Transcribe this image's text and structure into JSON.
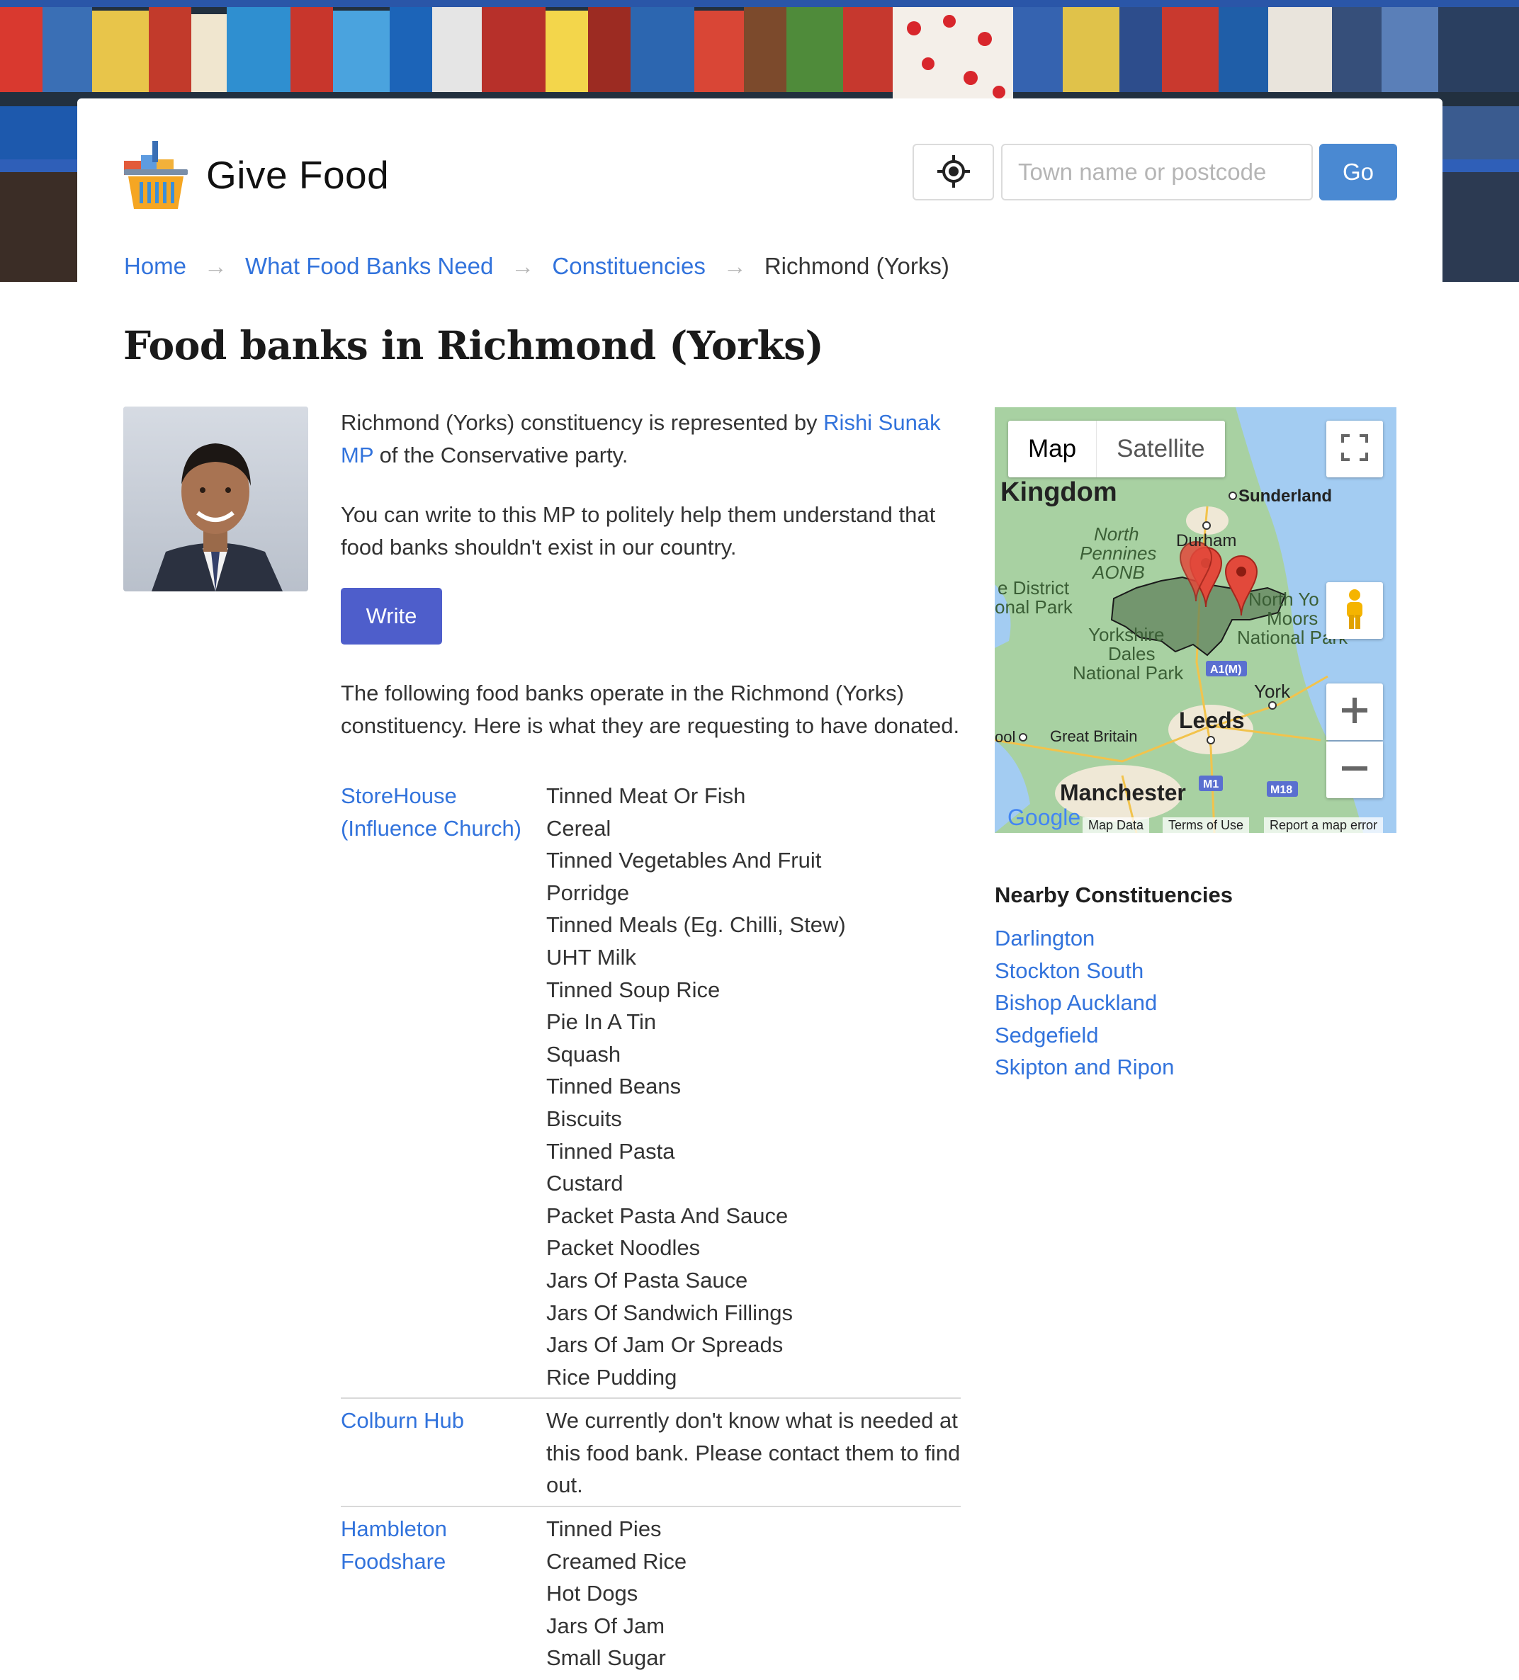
{
  "site": {
    "name": "Give Food"
  },
  "search": {
    "placeholder": "Town name or postcode",
    "go_label": "Go"
  },
  "breadcrumb": {
    "items": [
      "Home",
      "What Food Banks Need",
      "Constituencies"
    ],
    "current": "Richmond (Yorks)",
    "separator": "→"
  },
  "page": {
    "title": "Food banks in Richmond (Yorks)"
  },
  "mp": {
    "intro_before": "Richmond (Yorks) constituency is represented by ",
    "name_link": "Rishi Sunak MP",
    "intro_after": " of the Conservative party.",
    "write_text": "You can write to this MP to politely help them understand that food banks shouldn't exist in our country.",
    "write_button": "Write"
  },
  "foodbanks_intro": "The following food banks operate in the Richmond (Yorks) constituency. Here is what they are requesting to have donated.",
  "foodbanks": [
    {
      "name": "StoreHouse (Influence Church)",
      "needs": [
        "Tinned Meat Or Fish",
        "Cereal",
        "Tinned Vegetables And Fruit",
        "Porridge",
        "Tinned Meals (Eg. Chilli, Stew)",
        "UHT Milk",
        "Tinned Soup Rice",
        "Pie In A Tin",
        "Squash",
        "Tinned Beans",
        "Biscuits",
        "Tinned Pasta",
        "Custard",
        "Packet Pasta And Sauce",
        "Packet Noodles",
        "Jars Of Pasta Sauce",
        "Jars Of Sandwich Fillings",
        "Jars Of Jam Or Spreads",
        "Rice Pudding"
      ]
    },
    {
      "name": "Colburn Hub",
      "unknown": "We currently don't know what is needed at this food bank. Please contact them to find out."
    },
    {
      "name": "Hambleton Foodshare",
      "needs": [
        "Tinned Pies",
        "Creamed Rice",
        "Hot Dogs",
        "Jars Of Jam",
        "Small Sugar"
      ]
    }
  ],
  "map": {
    "type_map": "Map",
    "type_satellite": "Satellite",
    "labels": [
      "Kingdom",
      "Sunderland",
      "Durham",
      "North Pennines AONB",
      "e District",
      "onal Park",
      "North Yo",
      "Moors",
      "National Park",
      "Yorkshire Dales National Park",
      "A1(M)",
      "York",
      "Great Britain",
      "Leeds",
      "Manchester",
      "M1",
      "M18",
      "ool"
    ],
    "footer": [
      "Map Data",
      "Terms of Use",
      "Report a map error"
    ],
    "brand": "Google"
  },
  "nearby": {
    "heading": "Nearby Constituencies",
    "items": [
      "Darlington",
      "Stockton South",
      "Bishop Auckland",
      "Sedgefield",
      "Skipton and Ripon"
    ]
  },
  "colors": {
    "link": "#3273dc",
    "go_button": "#4a89d2",
    "write_button": "#4e5ecb",
    "title": "#1a1a1a"
  }
}
